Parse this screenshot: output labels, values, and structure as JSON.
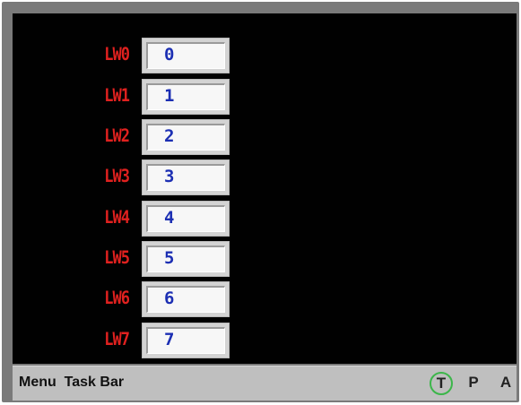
{
  "registers": [
    {
      "label": "LW0",
      "value": "0"
    },
    {
      "label": "LW1",
      "value": "1"
    },
    {
      "label": "LW2",
      "value": "2"
    },
    {
      "label": "LW3",
      "value": "3"
    },
    {
      "label": "LW4",
      "value": "4"
    },
    {
      "label": "LW5",
      "value": "5"
    },
    {
      "label": "LW6",
      "value": "6"
    },
    {
      "label": "LW7",
      "value": "7"
    }
  ],
  "taskbar": {
    "label": "Menu  Task Bar",
    "buttons": {
      "t": "T",
      "p": "P",
      "a": "A"
    }
  },
  "colors": {
    "label": "#e0211f",
    "value": "#1c2fb3",
    "screen": "#010101",
    "active_indicator": "#3cb64a"
  }
}
